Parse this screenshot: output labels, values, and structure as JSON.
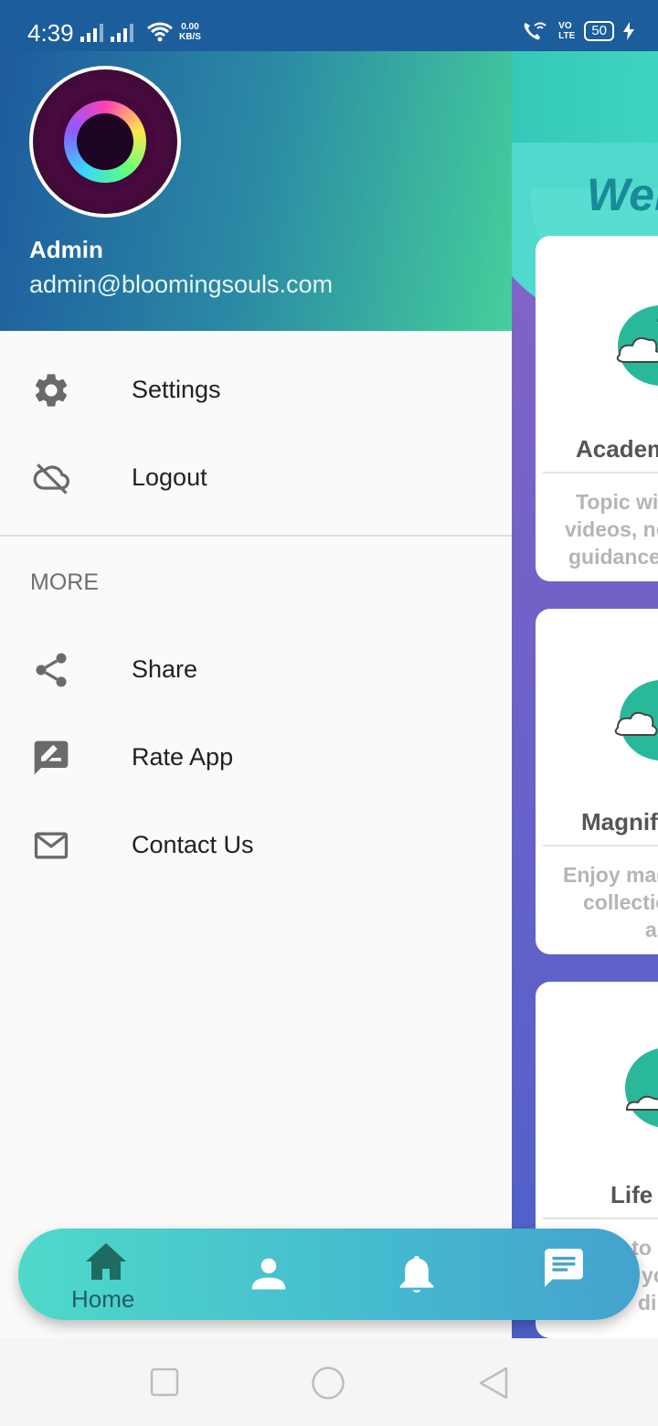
{
  "status_bar": {
    "time": "4:39",
    "network_speed_value": "0.00",
    "network_speed_unit": "KB/S",
    "volte_top": "VO",
    "volte_bottom": "LTE",
    "battery": "50"
  },
  "drawer": {
    "user": {
      "name": "Admin",
      "email": "admin@bloomingsouls.com"
    },
    "items": [
      {
        "label": "Settings",
        "icon": "gear-icon"
      },
      {
        "label": "Logout",
        "icon": "cloud-off-icon"
      }
    ],
    "section_label": "MORE",
    "more_items": [
      {
        "label": "Share",
        "icon": "share-icon"
      },
      {
        "label": "Rate App",
        "icon": "rate-review-icon"
      },
      {
        "label": "Contact Us",
        "icon": "mail-icon"
      }
    ]
  },
  "background_app": {
    "welcome": "Wel",
    "cards": [
      {
        "title": "Academ",
        "desc_lines": [
          "Topic wis",
          "videos, no",
          "guidance"
        ]
      },
      {
        "title": "Magnifi",
        "desc_lines": [
          "Enjoy mag",
          "collectio",
          "a"
        ]
      },
      {
        "title": "Life",
        "desc_lines": [
          "s to",
          "yo",
          "di"
        ]
      }
    ]
  },
  "bottom_nav": {
    "items": [
      {
        "label": "Home",
        "icon": "home-icon"
      },
      {
        "label": "",
        "icon": "person-icon"
      },
      {
        "label": "",
        "icon": "bell-icon"
      },
      {
        "label": "",
        "icon": "chat-icon"
      }
    ]
  },
  "colors": {
    "header_start": "#1d5b9e",
    "header_end": "#45cf9b",
    "nav_start": "#4fd9c9",
    "nav_end": "#45a2cd"
  }
}
